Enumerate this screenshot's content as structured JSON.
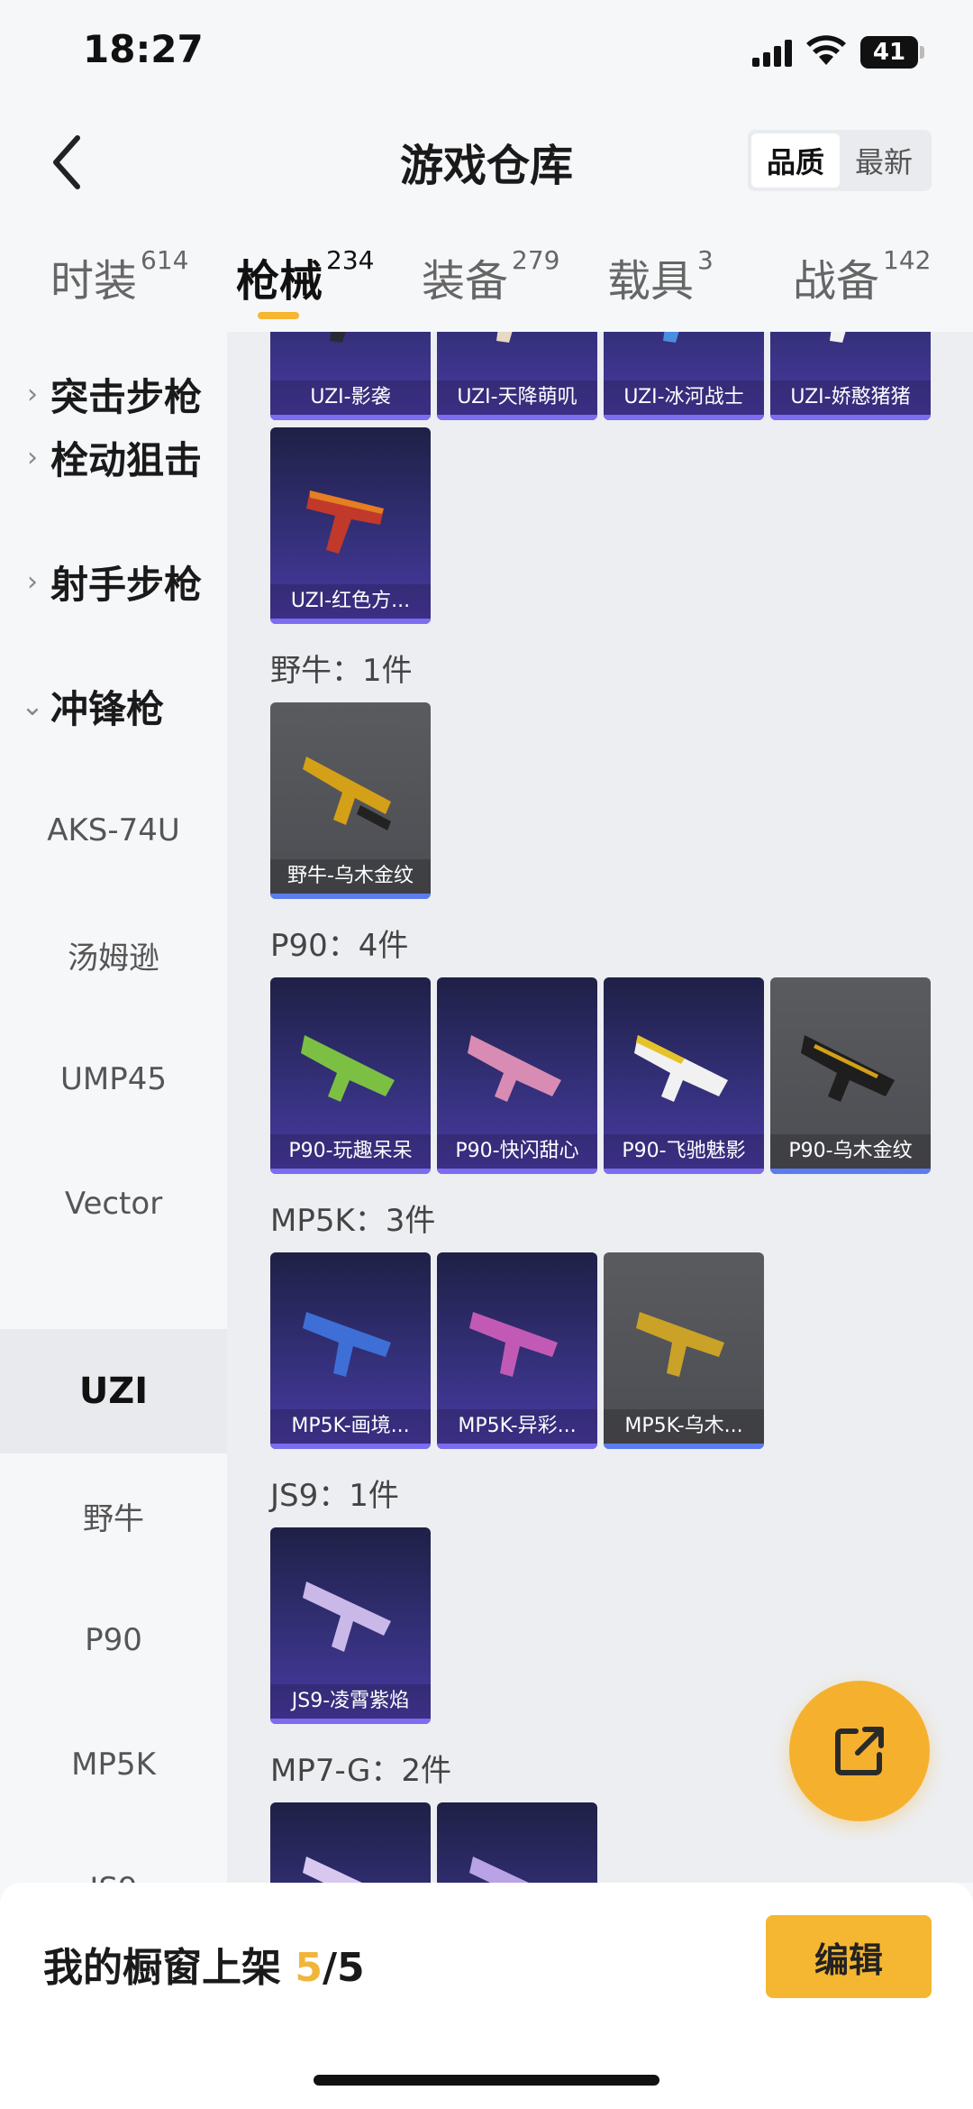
{
  "status_bar": {
    "time": "18:27",
    "battery": "41"
  },
  "header": {
    "title": "游戏仓库",
    "sort": [
      "品质",
      "最新"
    ]
  },
  "tabs": [
    {
      "label": "时装",
      "count": "614"
    },
    {
      "label": "枪械",
      "count": "234"
    },
    {
      "label": "装备",
      "count": "279"
    },
    {
      "label": "载具",
      "count": "3"
    },
    {
      "label": "战备",
      "count": "142"
    }
  ],
  "sidebar": {
    "groups": [
      {
        "label": "突击步枪",
        "icon": "chevron-right-icon"
      },
      {
        "label": "栓动狙击",
        "icon": "chevron-right-icon"
      },
      {
        "label": "射手步枪",
        "icon": "chevron-right-icon"
      },
      {
        "label": "冲锋枪",
        "icon": "chevron-down-icon"
      }
    ],
    "items": [
      "AKS-74U",
      "汤姆逊",
      "UMP45",
      "Vector",
      "UZI",
      "野牛",
      "P90",
      "MP5K",
      "JS9"
    ],
    "selected": "UZI"
  },
  "content": {
    "uzi_row": [
      "UZI-影袭",
      "UZI-天降萌叽",
      "UZI-冰河战士",
      "UZI-娇憨猪猪"
    ],
    "uzi_extra": "UZI-红色方...",
    "sections": [
      {
        "title": "野牛：1件",
        "items": [
          "野牛-乌木金纹"
        ]
      },
      {
        "title": "P90：4件",
        "items": [
          "P90-玩趣呆呆",
          "P90-快闪甜心",
          "P90-飞驰魅影",
          "P90-乌木金纹"
        ]
      },
      {
        "title": "MP5K：3件",
        "items": [
          "MP5K-画境...",
          "MP5K-异彩...",
          "MP5K-乌木..."
        ]
      },
      {
        "title": "JS9：1件",
        "items": [
          "JS9-凌霄紫焰"
        ]
      },
      {
        "title": "MP7-G：2件",
        "items": [
          "",
          ""
        ]
      }
    ]
  },
  "bottom": {
    "showcase_label": "我的橱窗上架 ",
    "showcase_count": "5",
    "showcase_total": "/5",
    "edit_label": "编辑"
  },
  "colors": {
    "accent": "#f5b731",
    "card_purple": "#34307a",
    "card_grey": "#54555a"
  }
}
